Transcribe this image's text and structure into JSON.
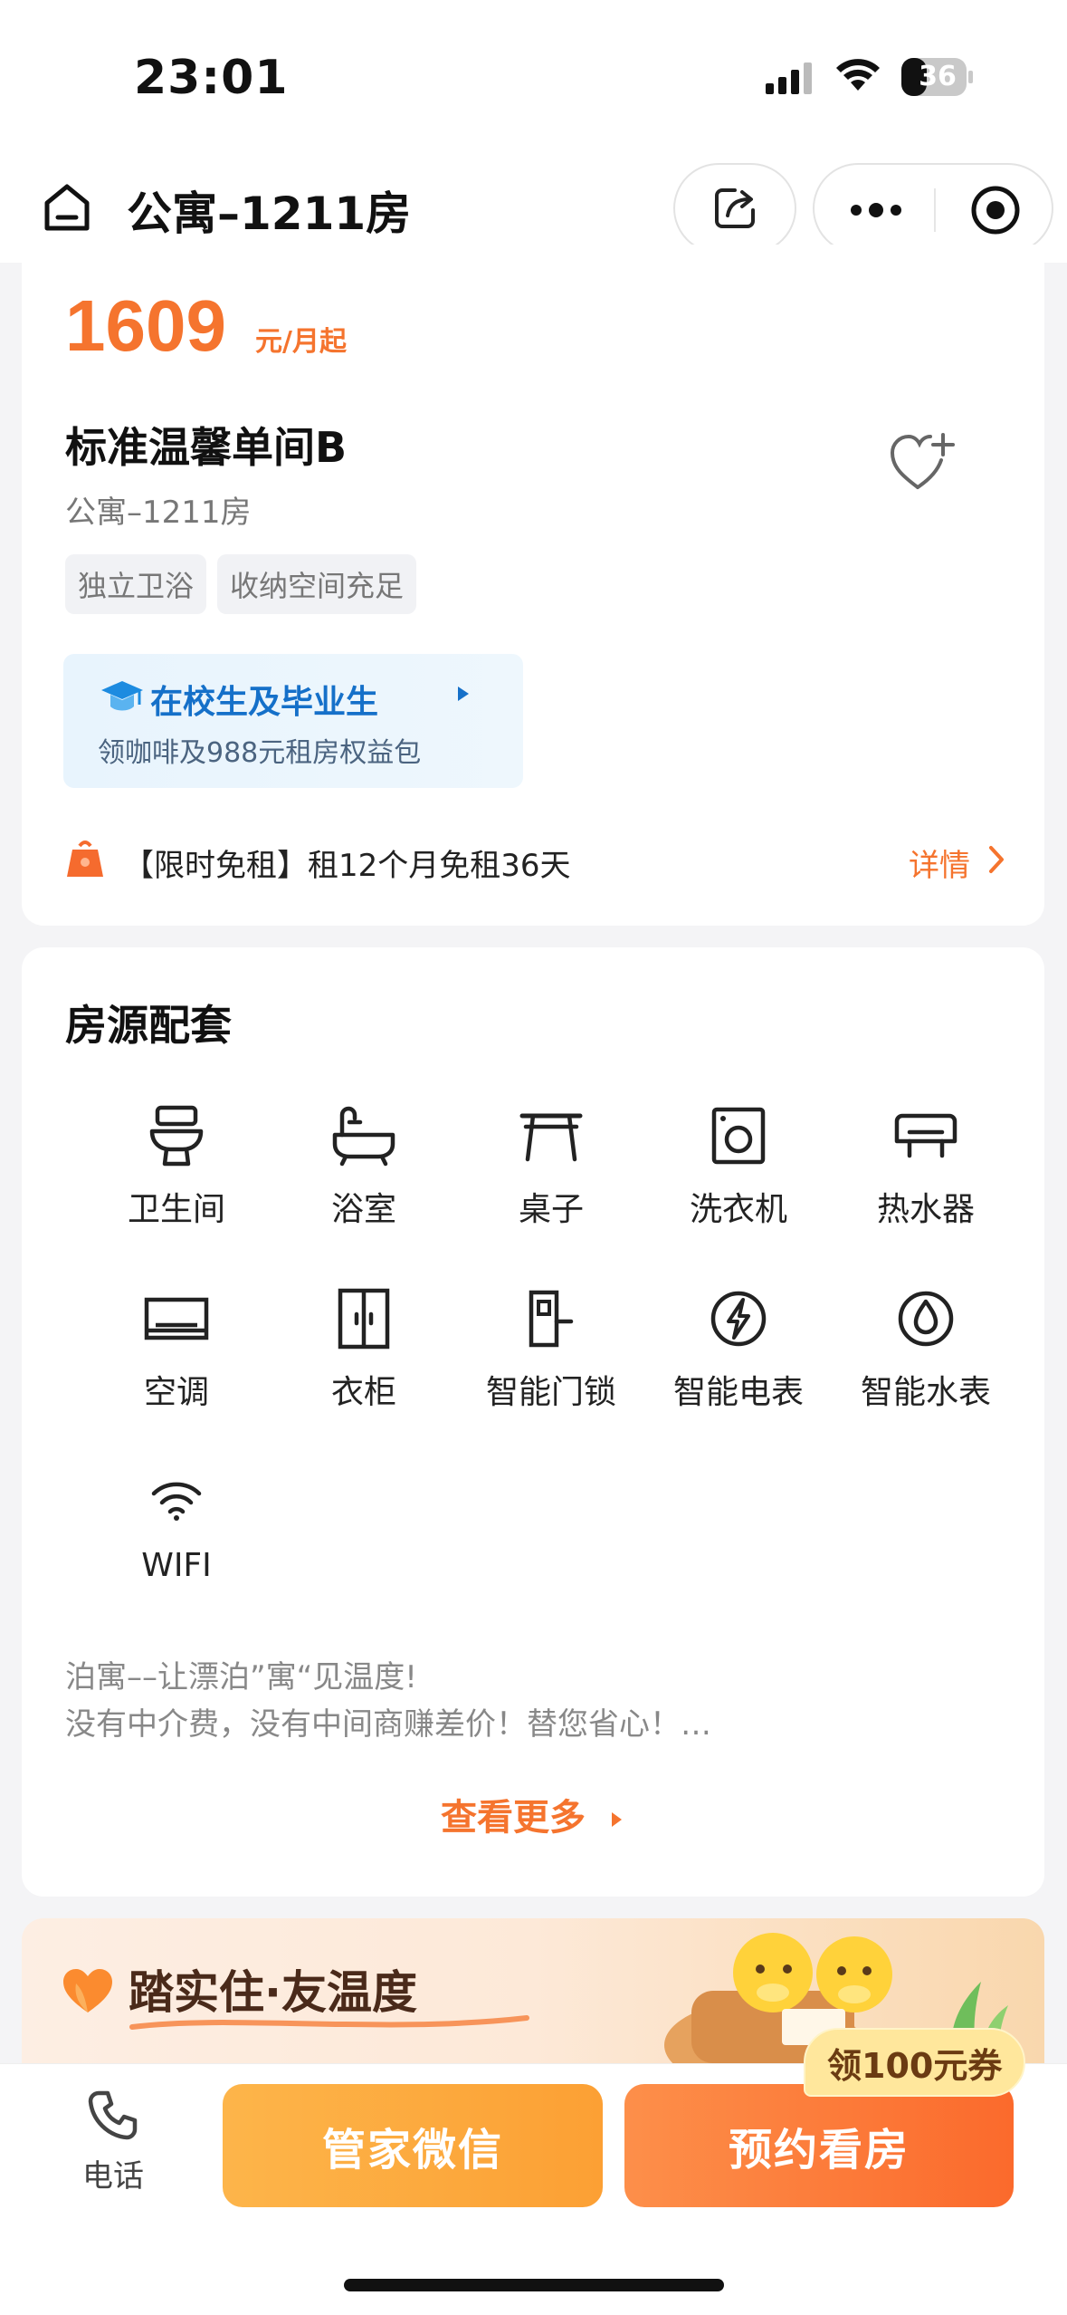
{
  "status_bar": {
    "time": "23:01",
    "battery": "36"
  },
  "nav": {
    "title": "公寓–1211房"
  },
  "room": {
    "price": "1609",
    "price_unit": "元/月起",
    "name": "标准温馨单间B",
    "subtitle": "公寓–1211房",
    "tags": [
      "独立卫浴",
      "收纳空间充足"
    ]
  },
  "student_banner": {
    "title": "在校生及毕业生",
    "subtitle": "领咖啡及988元租房权益包"
  },
  "promo": {
    "text": "【限时免租】租12个月免租36天",
    "detail": "详情"
  },
  "amenities": {
    "title": "房源配套",
    "items": [
      {
        "label": "卫生间",
        "icon": "toilet-icon"
      },
      {
        "label": "浴室",
        "icon": "bathtub-icon"
      },
      {
        "label": "桌子",
        "icon": "desk-icon"
      },
      {
        "label": "洗衣机",
        "icon": "washing-machine-icon"
      },
      {
        "label": "热水器",
        "icon": "water-heater-icon"
      },
      {
        "label": "空调",
        "icon": "air-conditioner-icon"
      },
      {
        "label": "衣柜",
        "icon": "wardrobe-icon"
      },
      {
        "label": "智能门锁",
        "icon": "smart-lock-icon"
      },
      {
        "label": "智能电表",
        "icon": "smart-electric-meter-icon"
      },
      {
        "label": "智能水表",
        "icon": "smart-water-meter-icon"
      },
      {
        "label": "WIFI",
        "icon": "wifi-icon"
      }
    ],
    "desc_line1": "泊寓––让漂泊”寓“见温度!",
    "desc_line2": "没有中介费，没有中间商赚差价！替您省心！…",
    "see_more": "查看更多"
  },
  "banner": {
    "title": "踏实住·友温度"
  },
  "bottom_bar": {
    "phone_label": "电话",
    "wechat_button": "管家微信",
    "book_button": "预约看房",
    "coupon": "领100元券"
  },
  "colors": {
    "accent": "#f5742e",
    "student_blue": "#1570c9"
  }
}
